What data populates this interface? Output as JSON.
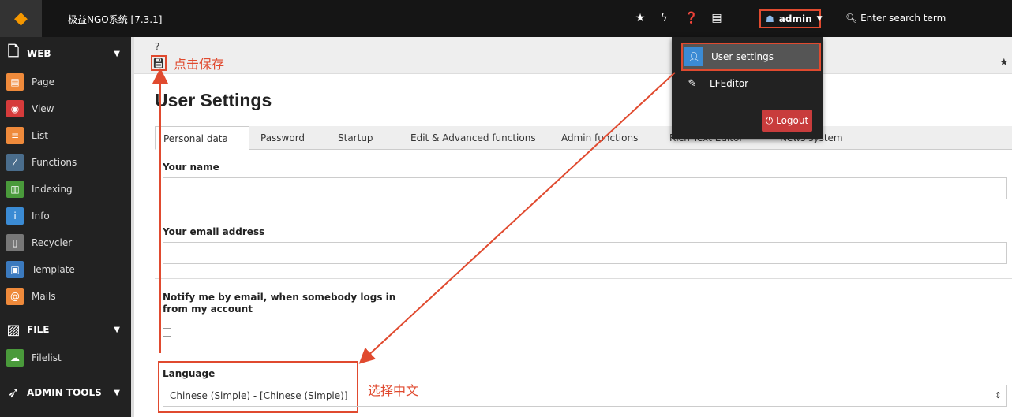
{
  "topbar": {
    "site_name": "极益NGO系统 [7.3.1]",
    "user_label": "admin",
    "search_placeholder": "Enter search term"
  },
  "sidebar": {
    "sections": [
      {
        "label": "WEB",
        "items": [
          {
            "label": "Page",
            "color": "#ef8a3b"
          },
          {
            "label": "View",
            "color": "#d63b3b"
          },
          {
            "label": "List",
            "color": "#ef8a3b"
          },
          {
            "label": "Functions",
            "color": "#4a6d8c"
          },
          {
            "label": "Indexing",
            "color": "#4a9a3b"
          },
          {
            "label": "Info",
            "color": "#3b8bd4"
          },
          {
            "label": "Recycler",
            "color": "#777777"
          },
          {
            "label": "Template",
            "color": "#3b7abf"
          },
          {
            "label": "Mails",
            "color": "#ef8a3b"
          }
        ]
      },
      {
        "label": "FILE",
        "items": [
          {
            "label": "Filelist",
            "color": "#4a9a3b"
          }
        ]
      },
      {
        "label": "ADMIN TOOLS",
        "items": []
      }
    ]
  },
  "header": {
    "help_icon": "?",
    "save_annotation": "点击保存"
  },
  "page": {
    "title": "User Settings"
  },
  "tabs": [
    "Personal data",
    "Password",
    "Startup",
    "Edit & Advanced functions",
    "Admin functions",
    "Rich Text Editor",
    "News system"
  ],
  "form": {
    "name_label": "Your name",
    "name_value": "",
    "email_label": "Your email address",
    "email_value": "",
    "notify_label_1": "Notify me by email, when somebody logs in",
    "notify_label_2": "from my account",
    "language_label": "Language",
    "language_value": "Chinese (Simple) - [Chinese (Simple)]",
    "language_annotation": "选择中文"
  },
  "dropdown": {
    "user_settings": "User settings",
    "lfeditor": "LFEditor",
    "logout": "Logout"
  },
  "colors": {
    "accent": "#e04a2f",
    "topbar": "#151515",
    "sidebar": "#222222"
  }
}
